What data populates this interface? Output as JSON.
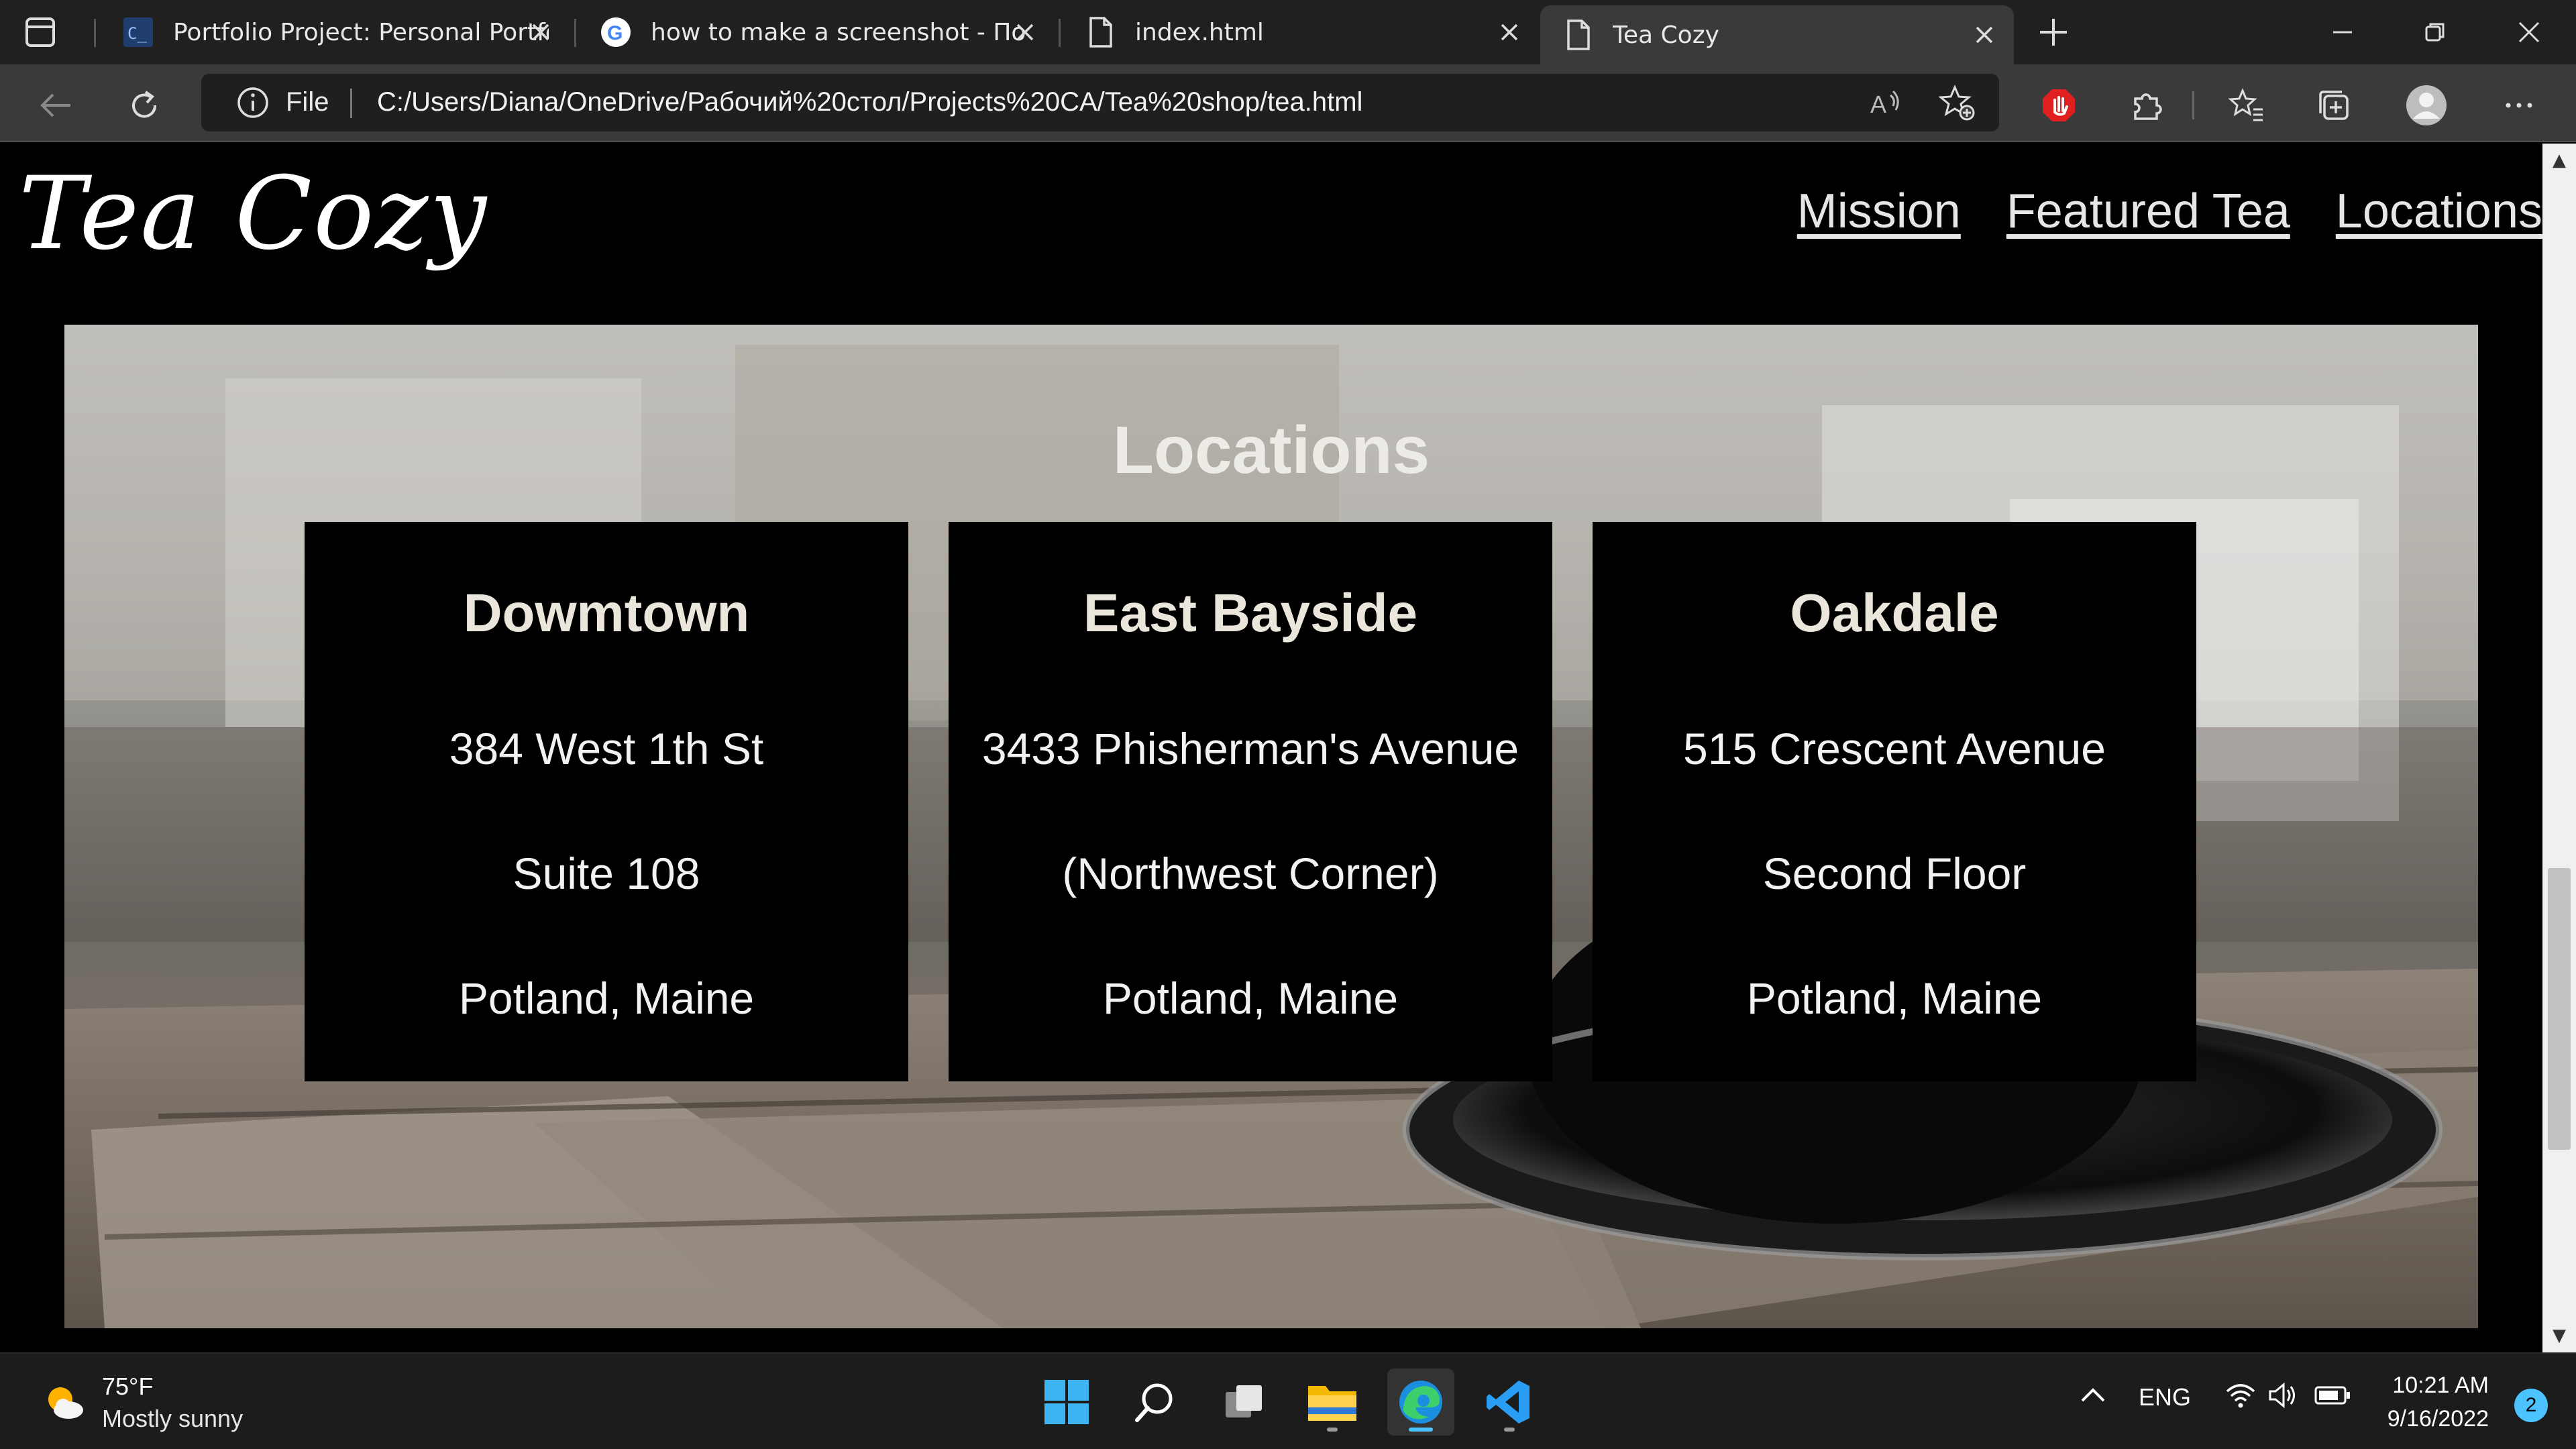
{
  "browser": {
    "tabs": [
      {
        "title": "Portfolio Project: Personal Portfo",
        "icon": "codecademy-icon"
      },
      {
        "title": "how to make a screenshot - Пои",
        "icon": "google-icon"
      },
      {
        "title": "index.html",
        "icon": "file-icon"
      },
      {
        "title": "Tea Cozy",
        "icon": "file-icon",
        "active": true
      }
    ],
    "address": {
      "scheme": "File",
      "url": "C:/Users/Diana/OneDrive/Рабочий%20стол/Projects%20CA/Tea%20shop/tea.html"
    }
  },
  "site": {
    "logo": "Tea Cozy",
    "nav": [
      "Mission",
      "Featured Tea",
      "Locations"
    ],
    "section_title": "Locations",
    "locations": [
      {
        "name": "Dowmtown",
        "line1": "384 West 1th St",
        "line2": "Suite 108",
        "line3": "Potland, Maine"
      },
      {
        "name": "East Bayside",
        "line1": "3433 Phisherman's Avenue",
        "line2": "(Northwest Corner)",
        "line3": "Potland, Maine"
      },
      {
        "name": "Oakdale",
        "line1": "515 Crescent Avenue",
        "line2": "Second Floor",
        "line3": "Potland, Maine"
      }
    ]
  },
  "taskbar": {
    "weather": {
      "temp": "75°F",
      "desc": "Mostly sunny"
    },
    "tray": {
      "language": "ENG"
    },
    "clock": {
      "time": "10:21 AM",
      "date": "9/16/2022"
    },
    "notifications": "2"
  },
  "colors": {
    "accent": "#4cc2ff",
    "page_bg": "#000000",
    "card_bg": "#000000",
    "heading": "#ebe6dc"
  }
}
